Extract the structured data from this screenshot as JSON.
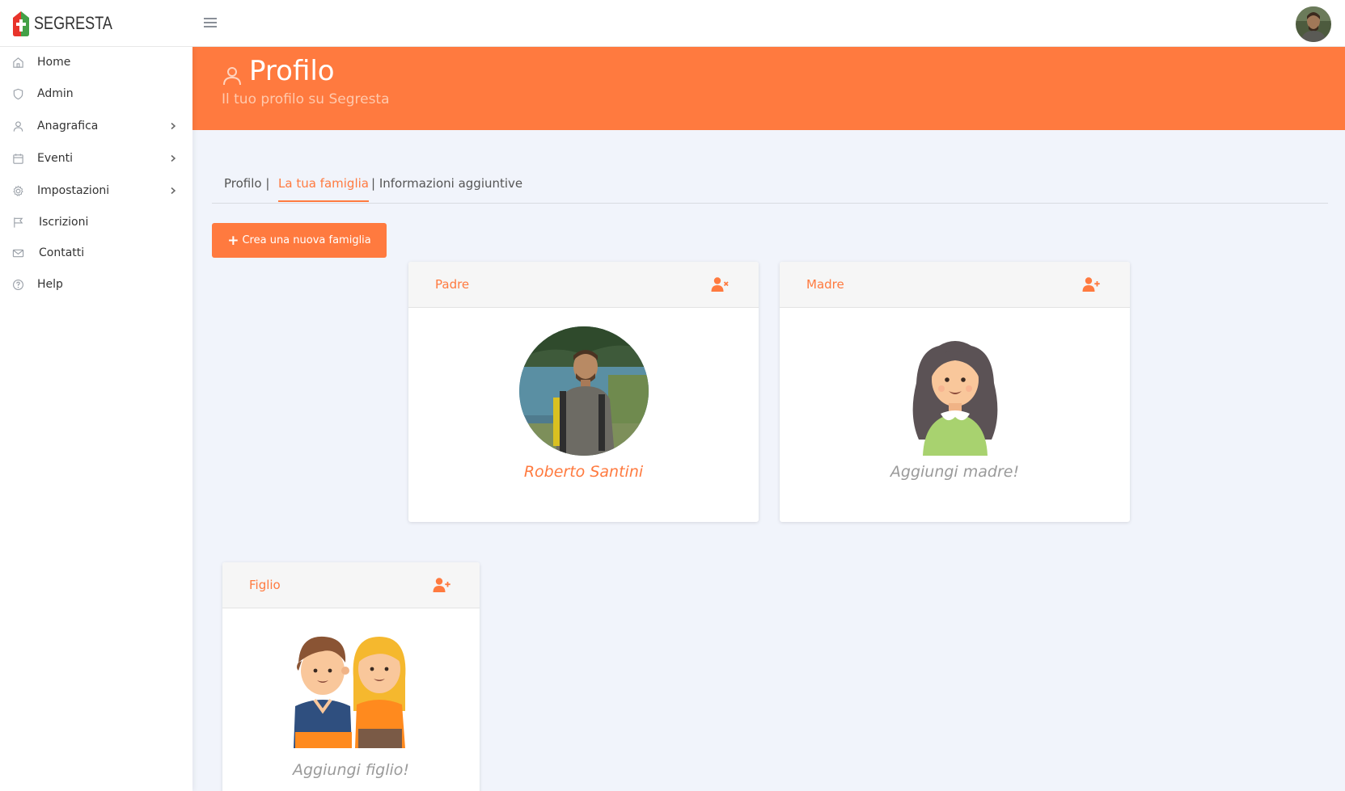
{
  "app": {
    "logo_text": "SEGRESTA"
  },
  "colors": {
    "accent": "#ff7a3f",
    "background": "#f1f4fb"
  },
  "sidebar": {
    "items": [
      {
        "label": "Home",
        "icon": "home-icon",
        "has_submenu": false
      },
      {
        "label": "Admin",
        "icon": "shield-icon",
        "has_submenu": false
      },
      {
        "label": "Anagrafica",
        "icon": "user-icon",
        "has_submenu": true
      },
      {
        "label": "Eventi",
        "icon": "calendar-icon",
        "has_submenu": true
      },
      {
        "label": "Impostazioni",
        "icon": "gear-icon",
        "has_submenu": true
      },
      {
        "label": "Iscrizioni",
        "icon": "flag-icon",
        "has_submenu": false
      },
      {
        "label": "Contatti",
        "icon": "mail-icon",
        "has_submenu": false
      },
      {
        "label": "Help",
        "icon": "help-circle-icon",
        "has_submenu": false
      }
    ]
  },
  "header": {
    "title": "Profilo",
    "subtitle": "Il tuo profilo su Segresta"
  },
  "tabs": [
    {
      "label": "Profilo |",
      "active": false
    },
    {
      "label": "La tua famiglia",
      "active": true
    },
    {
      "label": "| Informazioni aggiuntive",
      "active": false
    }
  ],
  "actions": {
    "new_family_label": "Crea una nuova famiglia"
  },
  "family": {
    "father": {
      "title": "Padre",
      "name": "Roberto Santini",
      "action_icon": "user-remove-icon"
    },
    "mother": {
      "title": "Madre",
      "name": "Aggiungi madre!",
      "action_icon": "user-add-icon"
    },
    "child": {
      "title": "Figlio",
      "name": "Aggiungi figlio!",
      "action_icon": "user-add-icon"
    }
  }
}
